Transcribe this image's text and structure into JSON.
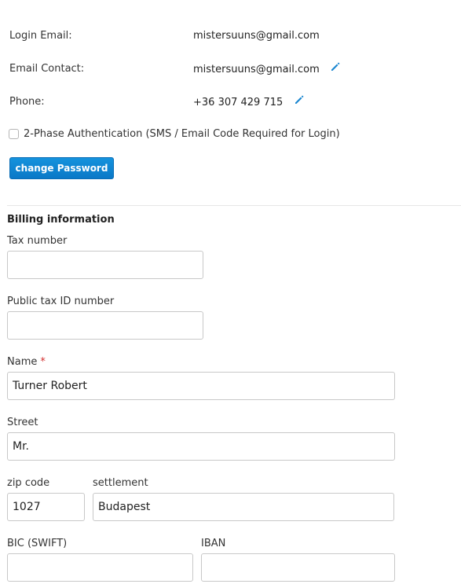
{
  "account": {
    "login_email_label": "Login Email:",
    "login_email_value": "mistersuuns@gmail.com",
    "email_contact_label": "Email Contact:",
    "email_contact_value": "mistersuuns@gmail.com",
    "phone_label": "Phone:",
    "phone_value": "+36 307 429 715",
    "two_factor_label": "2-Phase Authentication (SMS / Email Code Required for Login)",
    "two_factor_checked": false,
    "change_password_label": "change Password",
    "edit_icon": "pencil-icon",
    "accent_color": "#0a78c7"
  },
  "billing": {
    "title": "Billing information",
    "tax_number": {
      "label": "Tax number",
      "value": ""
    },
    "public_tax_id": {
      "label": "Public tax ID number",
      "value": ""
    },
    "name": {
      "label": "Name",
      "required_mark": "*",
      "value": "Turner Robert"
    },
    "street": {
      "label": "Street",
      "value": "Mr."
    },
    "zip_code": {
      "label": "zip code",
      "value": "1027"
    },
    "settlement": {
      "label": "settlement",
      "value": "Budapest"
    },
    "bic": {
      "label": "BIC (SWIFT)",
      "value": ""
    },
    "iban": {
      "label": "IBAN",
      "value": ""
    }
  }
}
